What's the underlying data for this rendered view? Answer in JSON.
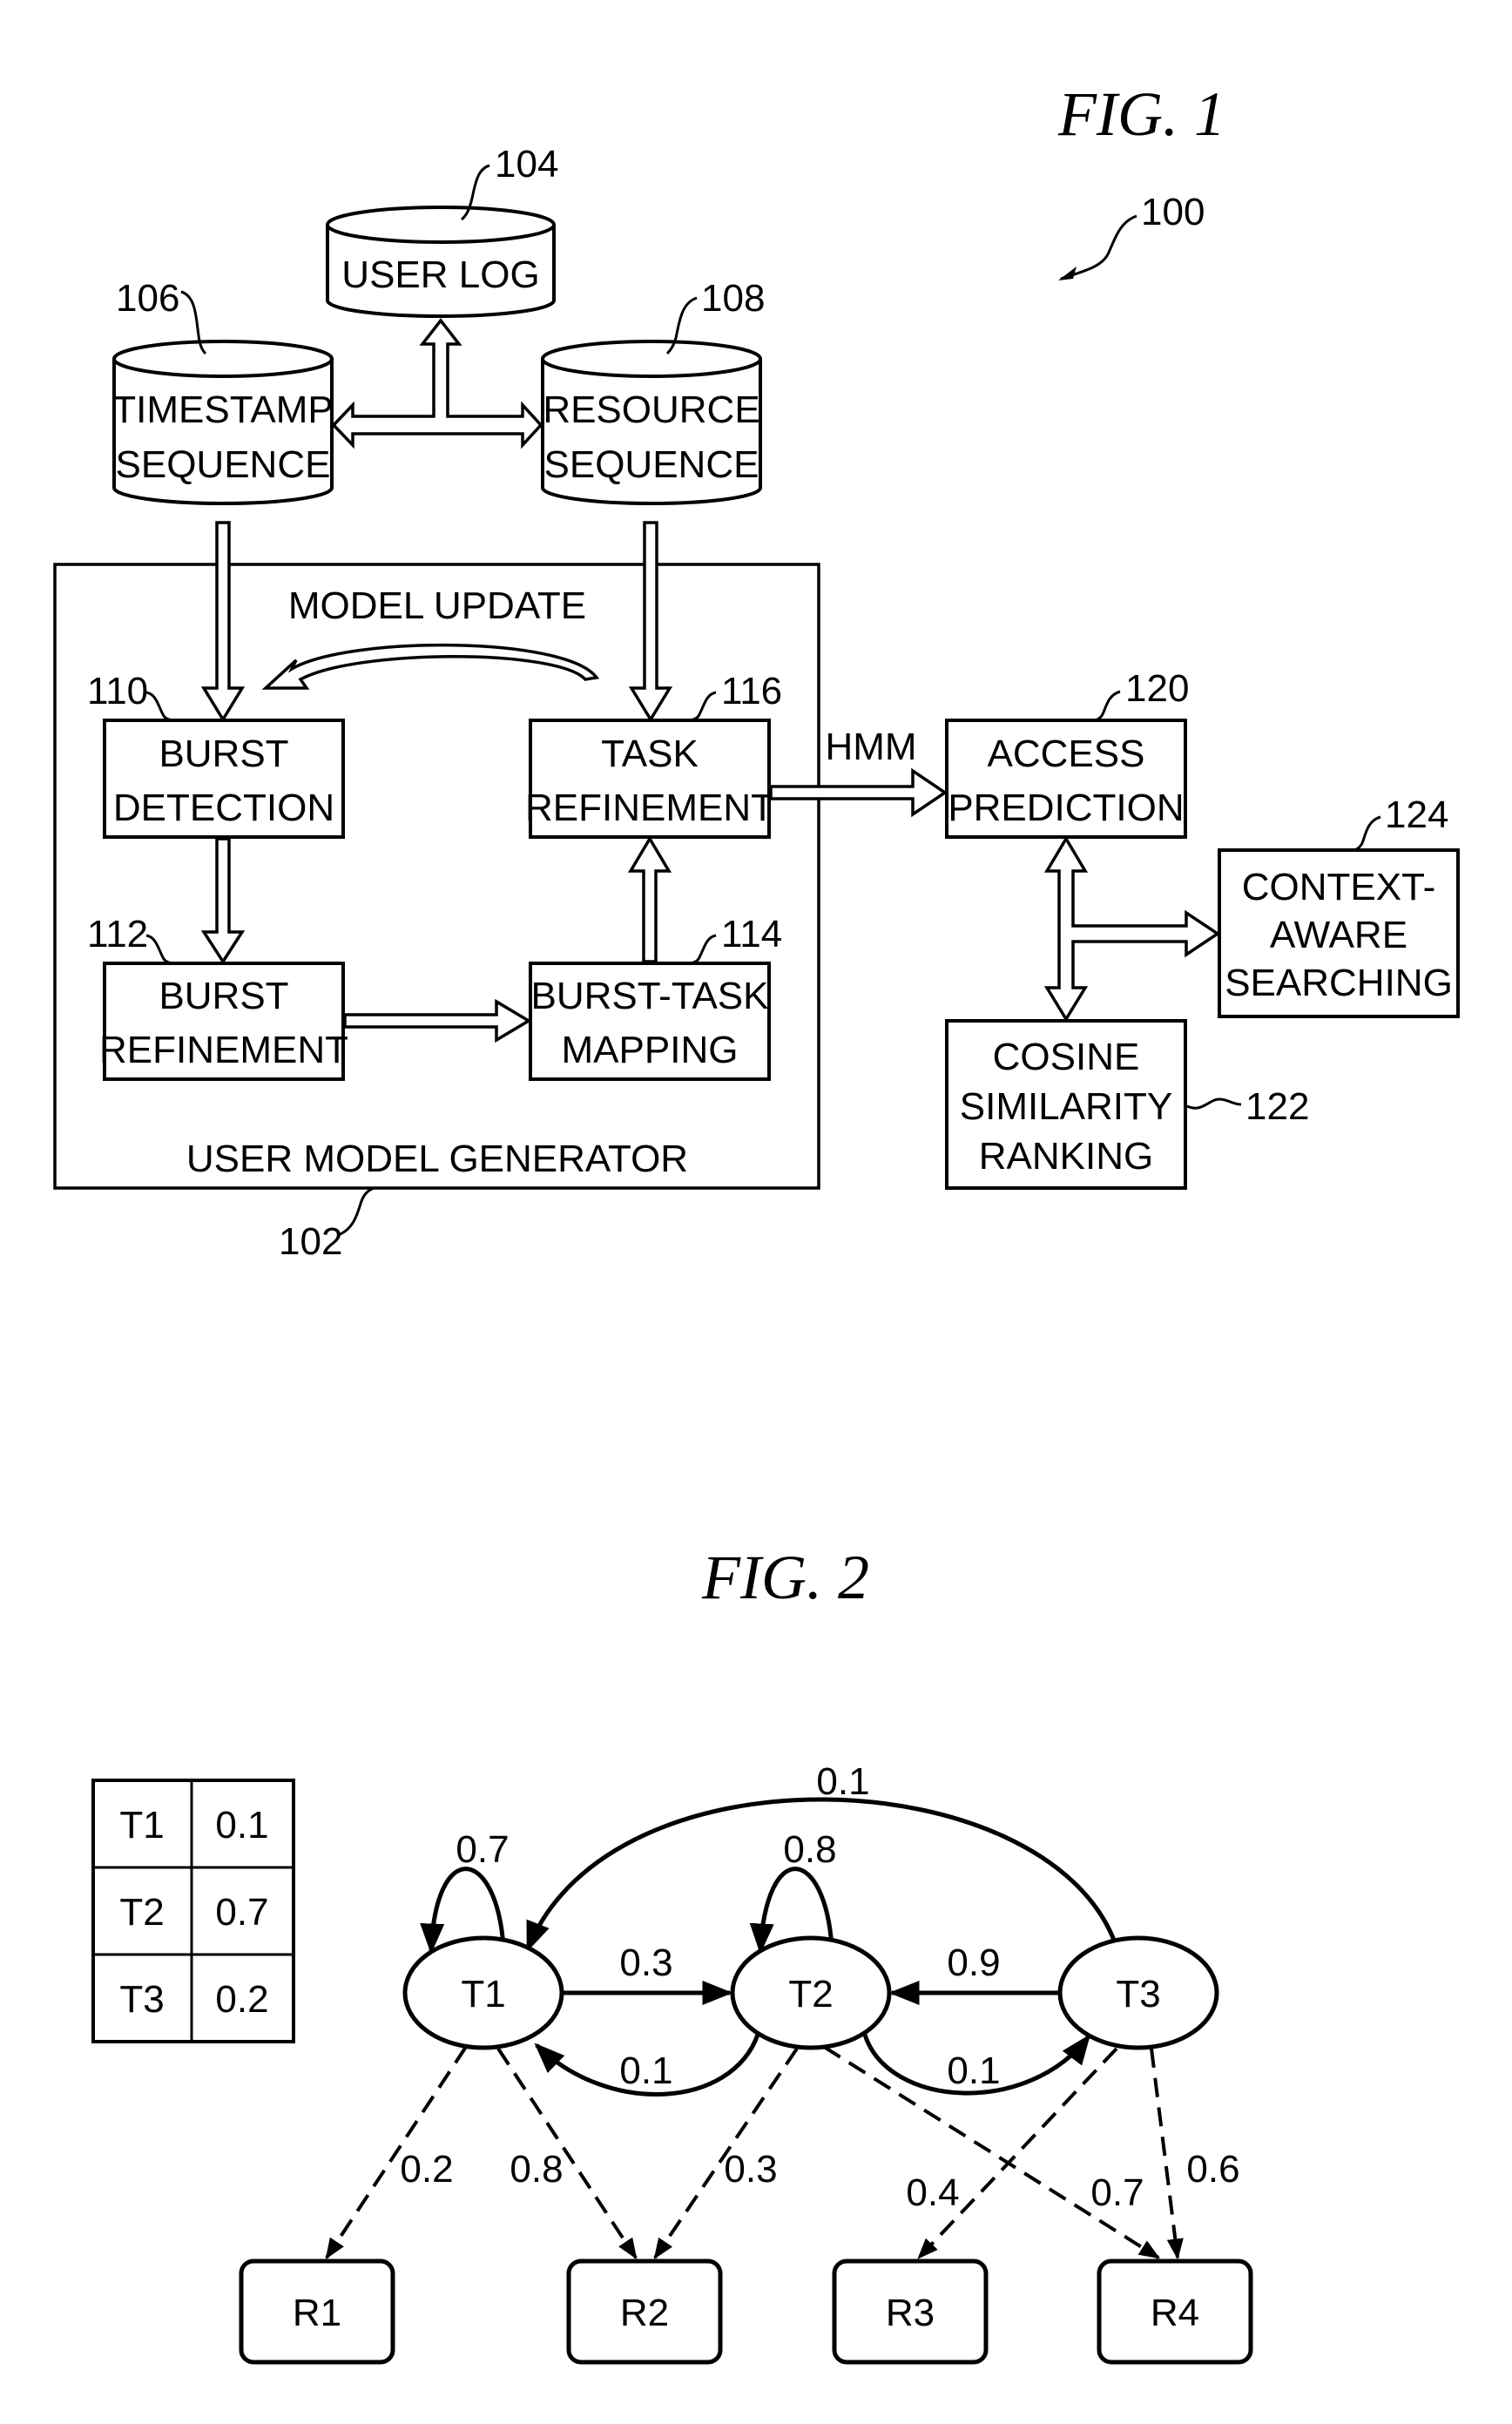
{
  "fig1": {
    "title": "FIG. 1",
    "system_ref": "100",
    "databases": {
      "user_log": {
        "ref": "104",
        "lines": [
          "USER LOG"
        ]
      },
      "timestamp_sequence": {
        "ref": "106",
        "lines": [
          "TIMESTAMP",
          "SEQUENCE"
        ]
      },
      "resource_sequence": {
        "ref": "108",
        "lines": [
          "RESOURCE",
          "SEQUENCE"
        ]
      }
    },
    "generator": {
      "ref": "102",
      "label": "USER MODEL GENERATOR",
      "model_update_label": "MODEL UPDATE",
      "blocks": {
        "burst_detection": {
          "ref": "110",
          "lines": [
            "BURST",
            "DETECTION"
          ]
        },
        "burst_refinement": {
          "ref": "112",
          "lines": [
            "BURST",
            "REFINEMENT"
          ]
        },
        "burst_task_mapping": {
          "ref": "114",
          "lines": [
            "BURST-TASK",
            "MAPPING"
          ]
        },
        "task_refinement": {
          "ref": "116",
          "lines": [
            "TASK",
            "REFINEMENT"
          ]
        }
      }
    },
    "hmm_label": "HMM",
    "access_prediction": {
      "ref": "120",
      "lines": [
        "ACCESS",
        "PREDICTION"
      ]
    },
    "cosine_ranking": {
      "ref": "122",
      "lines": [
        "COSINE",
        "SIMILARITY",
        "RANKING"
      ]
    },
    "context_search": {
      "ref": "124",
      "lines": [
        "CONTEXT-",
        "AWARE",
        "SEARCHING"
      ]
    }
  },
  "fig2": {
    "title": "FIG. 2",
    "initial_probabilities": [
      {
        "state": "T1",
        "value": "0.1"
      },
      {
        "state": "T2",
        "value": "0.7"
      },
      {
        "state": "T3",
        "value": "0.2"
      }
    ],
    "states": [
      "T1",
      "T2",
      "T3"
    ],
    "resources": [
      "R1",
      "R2",
      "R3",
      "R4"
    ],
    "transitions": [
      {
        "from": "T1",
        "to": "T1",
        "p": "0.7"
      },
      {
        "from": "T2",
        "to": "T2",
        "p": "0.8"
      },
      {
        "from": "T1",
        "to": "T2",
        "p": "0.3"
      },
      {
        "from": "T2",
        "to": "T1",
        "p": "0.1"
      },
      {
        "from": "T3",
        "to": "T2",
        "p": "0.9"
      },
      {
        "from": "T2",
        "to": "T3",
        "p": "0.1"
      },
      {
        "from": "T3",
        "to": "T1",
        "p": "0.1"
      }
    ],
    "emissions": [
      {
        "from": "T1",
        "to": "R1",
        "p": "0.2"
      },
      {
        "from": "T1",
        "to": "R2",
        "p": "0.8"
      },
      {
        "from": "T2",
        "to": "R2",
        "p": "0.3"
      },
      {
        "from": "T2",
        "to": "R4",
        "p": "0.7"
      },
      {
        "from": "T3",
        "to": "R3",
        "p": "0.4"
      },
      {
        "from": "T3",
        "to": "R4",
        "p": "0.6"
      }
    ]
  }
}
